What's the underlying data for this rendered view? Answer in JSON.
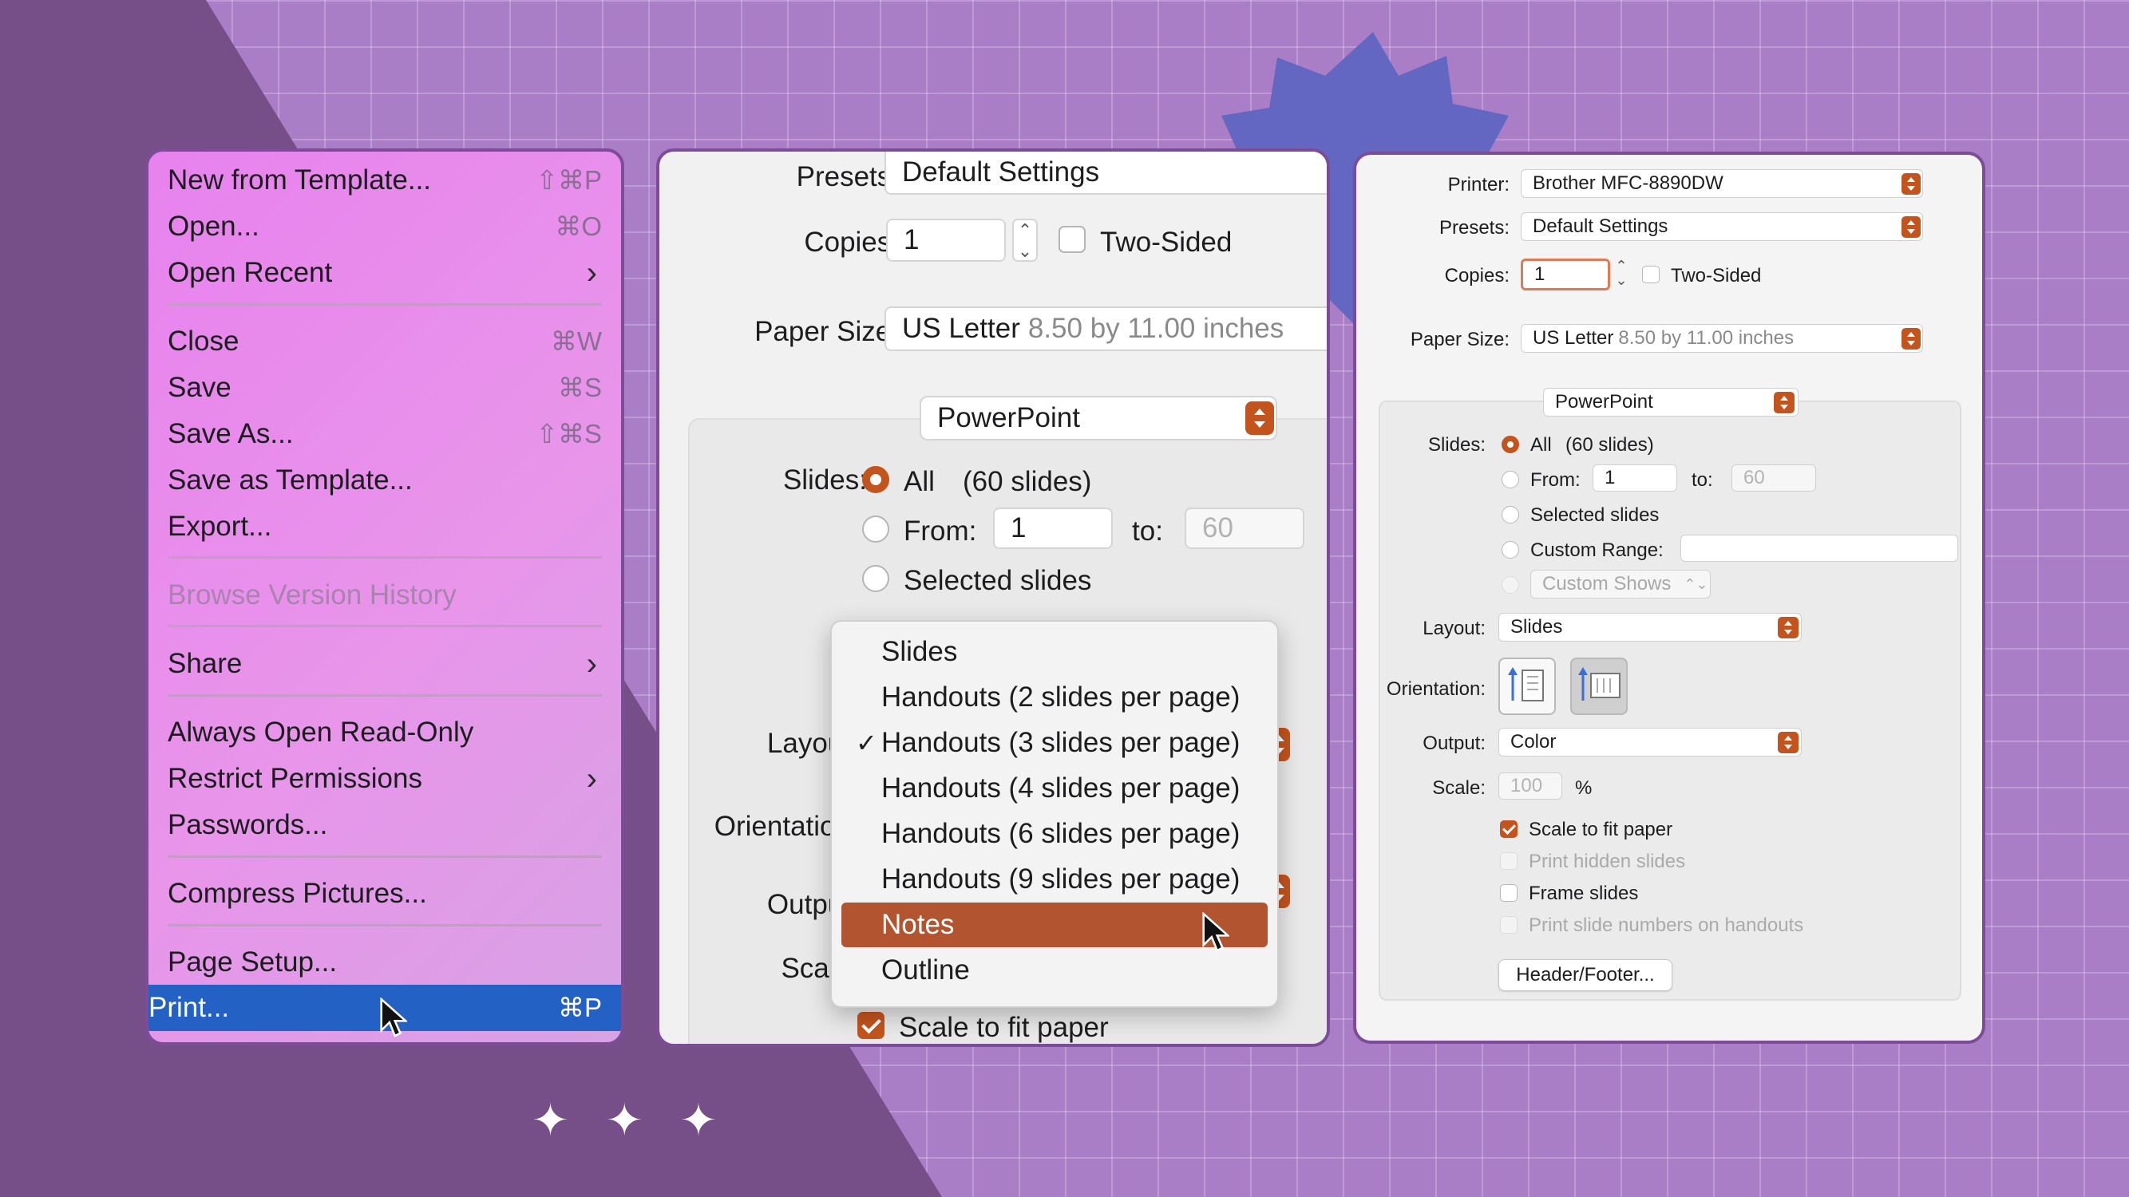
{
  "colors": {
    "background": "#a97ec6",
    "accent_orange": "#c4541d",
    "menu_highlight": "#2361c4",
    "panel_border": "#7d4c98"
  },
  "file_menu": {
    "items": [
      {
        "label": "New from Template...",
        "shortcut": "⇧⌘P"
      },
      {
        "label": "Open...",
        "shortcut": "⌘O"
      },
      {
        "label": "Open Recent",
        "submenu": true
      },
      {
        "label": "Close",
        "shortcut": "⌘W"
      },
      {
        "label": "Save",
        "shortcut": "⌘S"
      },
      {
        "label": "Save As...",
        "shortcut": "⇧⌘S"
      },
      {
        "label": "Save as Template..."
      },
      {
        "label": "Export..."
      },
      {
        "label": "Browse Version History",
        "disabled": true
      },
      {
        "label": "Share",
        "submenu": true
      },
      {
        "label": "Always Open Read-Only"
      },
      {
        "label": "Restrict Permissions",
        "submenu": true
      },
      {
        "label": "Passwords..."
      },
      {
        "label": "Compress Pictures..."
      },
      {
        "label": "Page Setup..."
      },
      {
        "label": "Print...",
        "shortcut": "⌘P",
        "highlighted": true
      }
    ]
  },
  "middle_dialog": {
    "presets_label": "Presets:",
    "presets_value": "Default Settings",
    "copies_label": "Copies:",
    "copies_value": "1",
    "two_sided_label": "Two-Sided",
    "paper_size_label": "Paper Size:",
    "paper_size_value": "US Letter",
    "paper_size_detail": "8.50 by 11.00 inches",
    "app_popup": "PowerPoint",
    "slides_label": "Slides:",
    "all_label": "All",
    "all_count": "(60 slides)",
    "from_label": "From:",
    "from_value": "1",
    "to_label": "to:",
    "to_value": "60",
    "selected_slides_label": "Selected slides",
    "layout_label": "Layout",
    "orientation_label": "Orientation",
    "output_label": "Output",
    "scale_label": "Scale",
    "scale_to_fit_label": "Scale to fit paper",
    "layout_options": [
      {
        "label": "Slides",
        "checked": false,
        "selected": false
      },
      {
        "label": "Handouts (2 slides per page)",
        "checked": false,
        "selected": false
      },
      {
        "label": "Handouts (3 slides per page)",
        "checked": true,
        "selected": false
      },
      {
        "label": "Handouts (4 slides per page)",
        "checked": false,
        "selected": false
      },
      {
        "label": "Handouts (6 slides per page)",
        "checked": false,
        "selected": false
      },
      {
        "label": "Handouts (9 slides per page)",
        "checked": false,
        "selected": false
      },
      {
        "label": "Notes",
        "checked": false,
        "selected": true
      },
      {
        "label": "Outline",
        "checked": false,
        "selected": false
      }
    ]
  },
  "right_dialog": {
    "printer_label": "Printer:",
    "printer_value": "Brother MFC-8890DW",
    "presets_label": "Presets:",
    "presets_value": "Default Settings",
    "copies_label": "Copies:",
    "copies_value": "1",
    "two_sided_label": "Two-Sided",
    "paper_size_label": "Paper Size:",
    "paper_size_value": "US Letter",
    "paper_size_detail": "8.50 by 11.00 inches",
    "app_popup": "PowerPoint",
    "slides_label": "Slides:",
    "all_label": "All",
    "all_count": "(60 slides)",
    "from_label": "From:",
    "from_value": "1",
    "to_label": "to:",
    "to_value": "60",
    "selected_slides_label": "Selected slides",
    "custom_range_label": "Custom Range:",
    "custom_shows_label": "Custom Shows",
    "layout_label": "Layout:",
    "layout_value": "Slides",
    "orientation_label": "Orientation:",
    "output_label": "Output:",
    "output_value": "Color",
    "scale_label": "Scale:",
    "scale_value": "100",
    "scale_unit": "%",
    "scale_to_fit_label": "Scale to fit paper",
    "print_hidden_label": "Print hidden slides",
    "frame_slides_label": "Frame slides",
    "print_numbers_label": "Print slide numbers on handouts",
    "header_footer_button": "Header/Footer..."
  },
  "decorations": {
    "sparkles": "✦ ✦ ✦"
  }
}
